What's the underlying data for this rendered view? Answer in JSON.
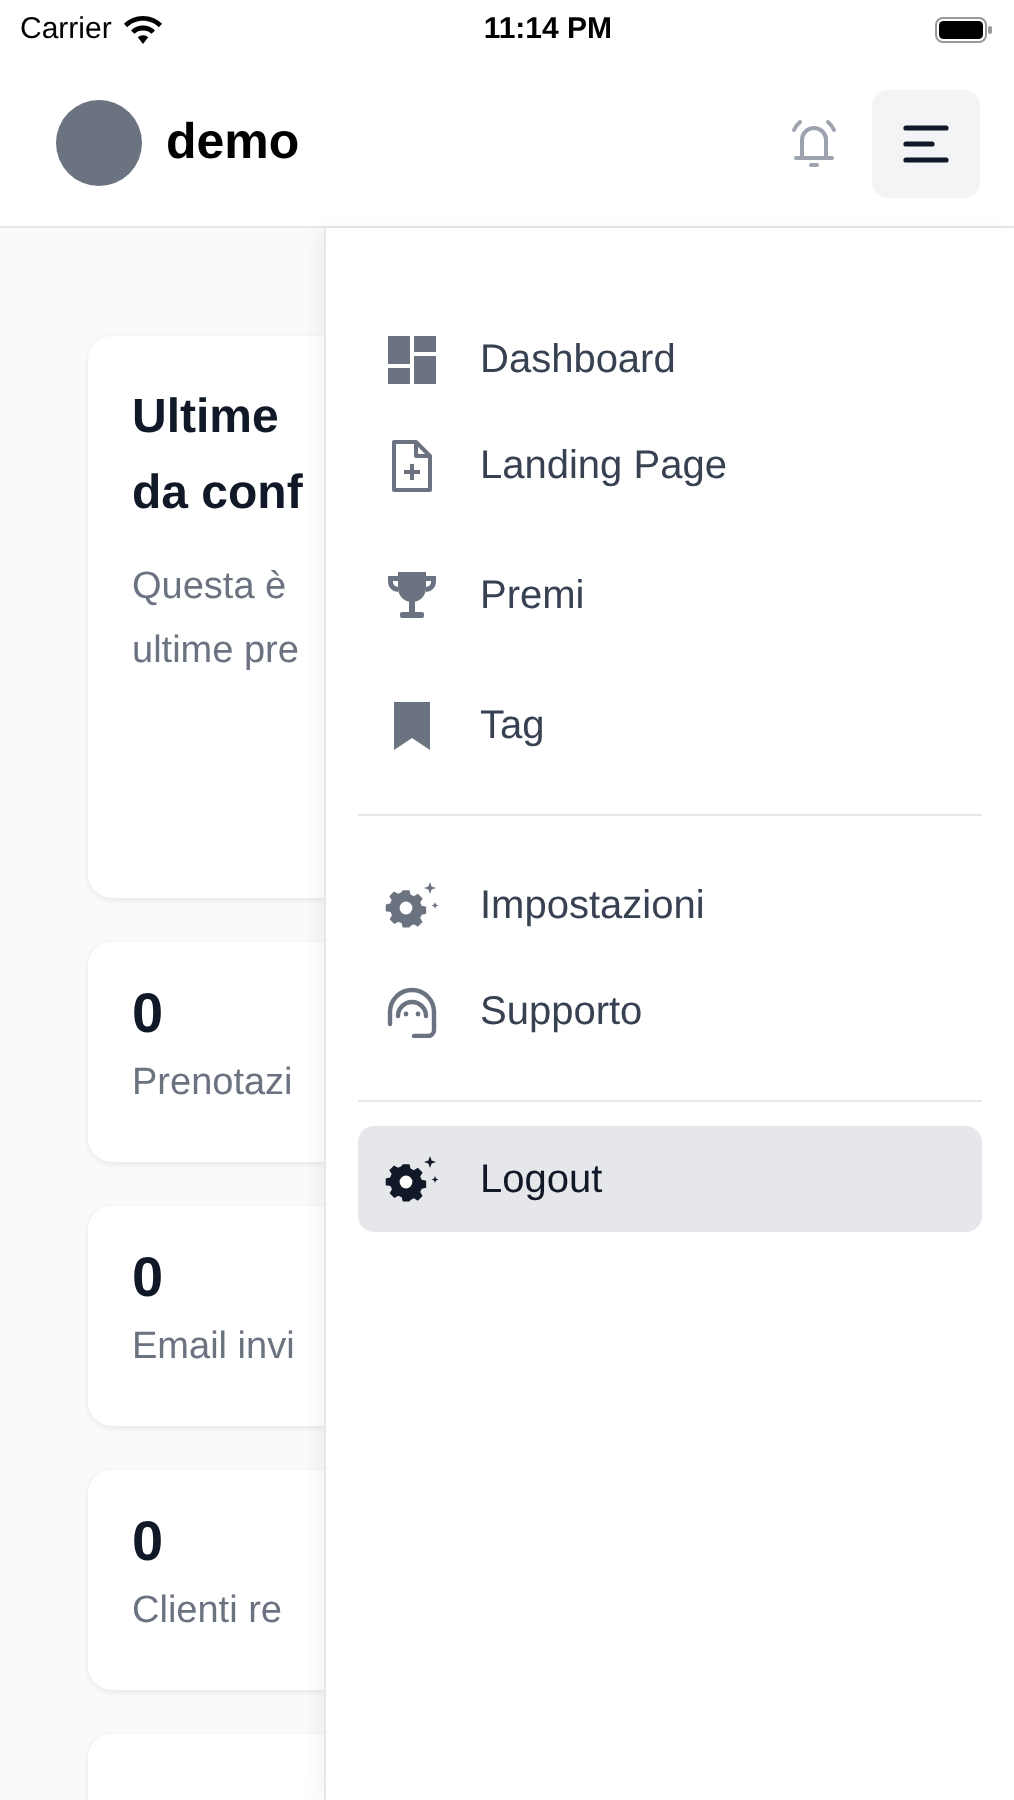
{
  "status_bar": {
    "carrier": "Carrier",
    "time": "11:14 PM"
  },
  "header": {
    "user": "demo"
  },
  "cards": [
    {
      "kind": "intro",
      "lines": [
        "Ultime",
        "da conf"
      ],
      "description": [
        "Questa è",
        "ultime pre"
      ]
    },
    {
      "kind": "stat",
      "value": "0",
      "label": "Prenotazi"
    },
    {
      "kind": "stat",
      "value": "0",
      "label": "Email invi"
    },
    {
      "kind": "stat",
      "value": "0",
      "label": "Clienti re"
    },
    {
      "kind": "empty"
    }
  ],
  "menu": {
    "sections": [
      {
        "items": [
          {
            "label": "Dashboard",
            "selected": false
          },
          {
            "label": "Landing Page",
            "selected": false
          },
          {
            "label": "Premi",
            "selected": false
          },
          {
            "label": "Tag",
            "selected": false
          }
        ]
      },
      {
        "items": [
          {
            "label": "Impostazioni",
            "selected": false
          },
          {
            "label": "Supporto",
            "selected": false
          }
        ]
      },
      {
        "items": [
          {
            "label": "Logout",
            "selected": true
          }
        ]
      }
    ]
  }
}
